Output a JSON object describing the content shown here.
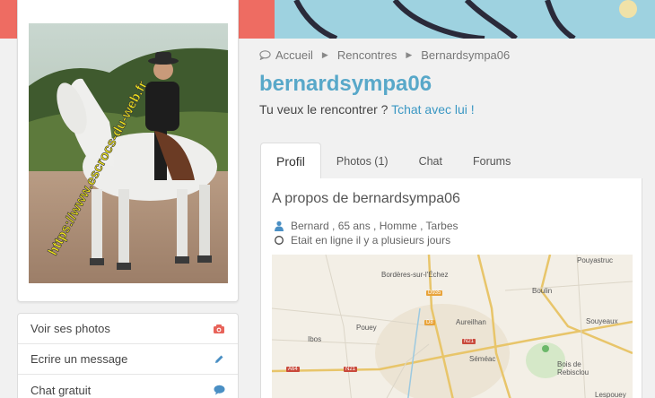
{
  "profile_photo": {
    "watermark": "https://www.escrocs-du-web.fr"
  },
  "actions": [
    {
      "label": "Voir ses photos",
      "icon": "camera-icon",
      "color": "#e8635a"
    },
    {
      "label": "Ecrire un message",
      "icon": "pencil-icon",
      "color": "#4a8fc4"
    },
    {
      "label": "Chat gratuit",
      "icon": "chat-bubble-icon",
      "color": "#4a8fc4"
    }
  ],
  "breadcrumb": {
    "home": "Accueil",
    "section": "Rencontres",
    "current": "Bernardsympa06"
  },
  "profile": {
    "username": "bernardsympa06",
    "tagline_prefix": "Tu veux le rencontrer ? ",
    "tagline_link": "Tchat avec lui !"
  },
  "tabs": [
    {
      "label": "Profil",
      "active": true
    },
    {
      "label": "Photos (1)",
      "active": false
    },
    {
      "label": "Chat",
      "active": false
    },
    {
      "label": "Forums",
      "active": false
    }
  ],
  "about": {
    "title": "A propos de bernardsympa06",
    "details": "Bernard , 65 ans , Homme , Tarbes",
    "status": "Etait en ligne il y a plusieurs jours"
  },
  "map": {
    "labels": [
      "Bordères-sur-l'Échez",
      "Pouyastruc",
      "Boulin",
      "Aureilhan",
      "Souyeaux",
      "Pouey",
      "Ibos",
      "Séméac",
      "Bois de Rebisclou",
      "Lespouey"
    ],
    "roads": [
      "D935",
      "N21",
      "A64",
      "N21",
      "D8"
    ]
  },
  "colors": {
    "accent": "#58a8c9",
    "link": "#3a97c3",
    "banner_blue": "#9ed2e0",
    "banner_pink": "#ee6c62"
  }
}
